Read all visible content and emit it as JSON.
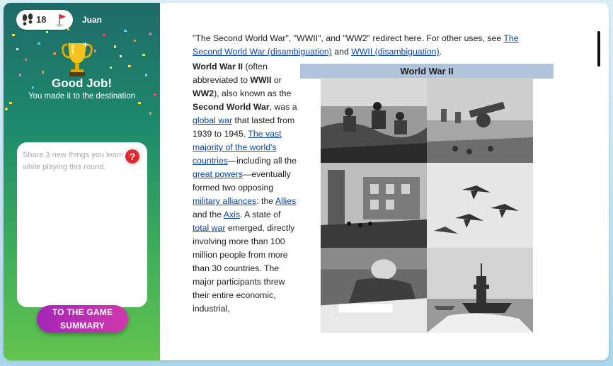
{
  "player": {
    "steps": "18",
    "name": "Juan"
  },
  "result": {
    "title": "Good Job!",
    "subtitle": "You made it to the destination"
  },
  "notes": {
    "placeholder": "Share 3 new things you learned while playing this round."
  },
  "summary_button": {
    "label": "TO THE GAME SUMMARY"
  },
  "article": {
    "hatnote": {
      "lead": "\"The Second World War\", \"WWII\", and \"WW2\" redirect here. For other uses, see ",
      "link1": "The Second World War (disambiguation)",
      "and": " and ",
      "link2": "WWII (disambiguation)",
      "end": "."
    },
    "body": [
      {
        "t": "b",
        "v": "World War II"
      },
      {
        "t": "s",
        "v": " (often abbreviated to "
      },
      {
        "t": "b",
        "v": "WWII"
      },
      {
        "t": "s",
        "v": " or "
      },
      {
        "t": "b",
        "v": "WW2"
      },
      {
        "t": "s",
        "v": "), also known as the "
      },
      {
        "t": "b",
        "v": "Second World War"
      },
      {
        "t": "s",
        "v": ", was a "
      },
      {
        "t": "a",
        "v": "global war"
      },
      {
        "t": "s",
        "v": " that lasted from 1939 to 1945. "
      },
      {
        "t": "a",
        "v": "The vast majority of the world's countries"
      },
      {
        "t": "s",
        "v": "—including all the "
      },
      {
        "t": "a",
        "v": "great powers"
      },
      {
        "t": "s",
        "v": "—eventually formed two opposing "
      },
      {
        "t": "a",
        "v": "military alliances"
      },
      {
        "t": "s",
        "v": ": the "
      },
      {
        "t": "a",
        "v": "Allies"
      },
      {
        "t": "s",
        "v": " and the "
      },
      {
        "t": "a",
        "v": "Axis"
      },
      {
        "t": "s",
        "v": ". A state of "
      },
      {
        "t": "a",
        "v": "total war"
      },
      {
        "t": "s",
        "v": " emerged, directly involving more than 100 million people from more than 30 countries. The major participants threw their entire economic, industrial,"
      }
    ],
    "infobox_title": "World War II"
  },
  "colors": {
    "panel_top": "#1e6b6a",
    "panel_bottom": "#63c44e",
    "button": "#b82fb3",
    "infobox_header": "#b0c4de",
    "link": "#0645ad"
  }
}
